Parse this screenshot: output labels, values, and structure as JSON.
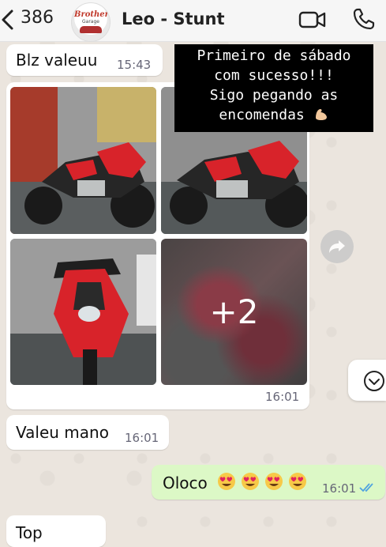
{
  "header": {
    "unread_count": "386",
    "contact_name": "Leo - Stunt",
    "avatar_brand": "Brother",
    "avatar_sub": "Garage"
  },
  "messages": [
    {
      "text": "Blz  valeuu",
      "time": "15:43",
      "direction": "in"
    },
    {
      "type": "album",
      "time": "16:01",
      "direction": "in",
      "extra_count": "+2"
    },
    {
      "text": "Valeu mano",
      "time": "16:01",
      "direction": "in"
    },
    {
      "text": "Oloco",
      "emoji_count": 4,
      "emoji": "heart-eyes",
      "time": "16:01",
      "direction": "out",
      "status": "read"
    },
    {
      "text": "Top",
      "direction": "in"
    }
  ],
  "story_caption": {
    "line1": "Primeiro de sábado",
    "line2": "com sucesso!!!",
    "line3": "Sigo pegando as",
    "line4": "encomendas",
    "emoji": "flexed-biceps"
  },
  "colors": {
    "incoming_bubble": "#ffffff",
    "outgoing_bubble": "#dcf8c6",
    "read_ticks": "#4fa3e0",
    "motorcycle_red": "#d8232a"
  }
}
